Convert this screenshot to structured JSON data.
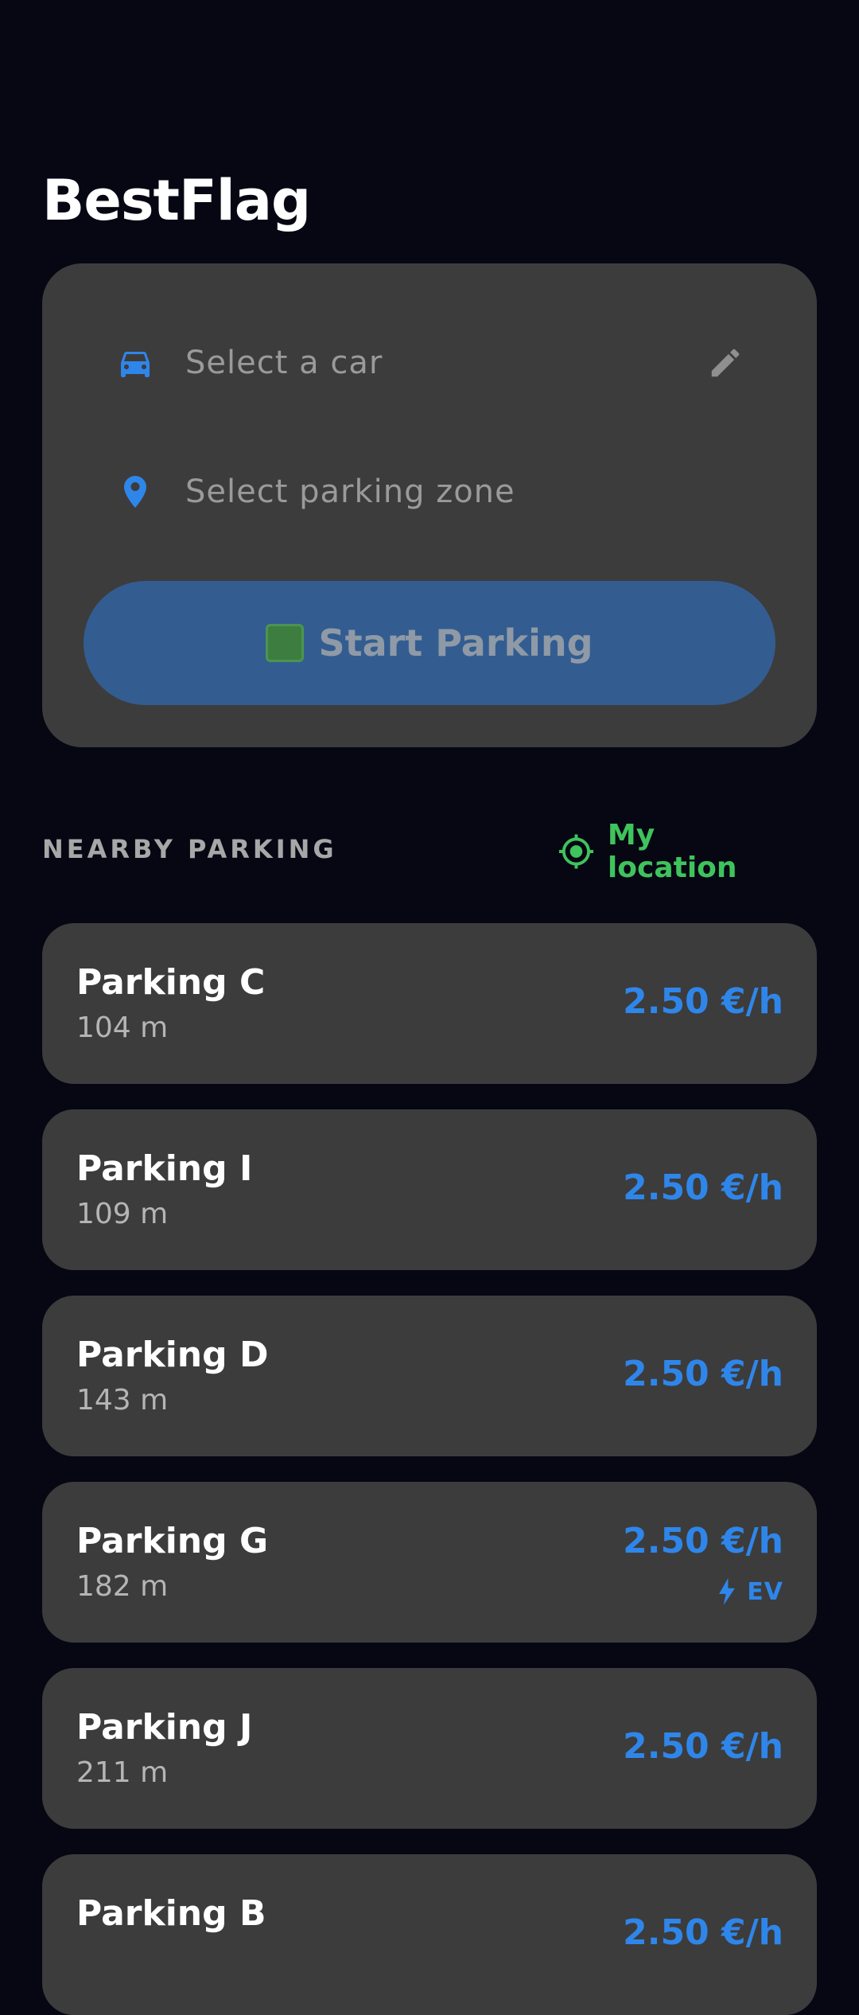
{
  "app": {
    "title": "BestFlag"
  },
  "booking": {
    "car_placeholder": "Select a car",
    "zone_placeholder": "Select parking zone",
    "start_button_label": "Start Parking",
    "icons": {
      "car": "car-icon",
      "zone": "location-pin-icon",
      "edit": "pencil-icon",
      "start": "stop-square-icon"
    }
  },
  "nearby": {
    "section_title": "NEARBY PARKING",
    "location_button_label": "My location",
    "location_icon": "crosshair-icon",
    "items": [
      {
        "name": "Parking C",
        "distance": "104 m",
        "price": "2.50 €/h",
        "ev": ""
      },
      {
        "name": "Parking I",
        "distance": "109 m",
        "price": "2.50 €/h",
        "ev": ""
      },
      {
        "name": "Parking D",
        "distance": "143 m",
        "price": "2.50 €/h",
        "ev": ""
      },
      {
        "name": "Parking G",
        "distance": "182 m",
        "price": "2.50 €/h",
        "ev": "EV"
      },
      {
        "name": "Parking J",
        "distance": "211 m",
        "price": "2.50 €/h",
        "ev": ""
      },
      {
        "name": "Parking B",
        "distance": "",
        "price": "2.50 €/h",
        "ev": ""
      }
    ]
  },
  "colors": {
    "background": "#060713",
    "card": "#3c3c3c",
    "accent_blue": "#2f86ea",
    "accent_green": "#3fc35d",
    "button_blue": "#335d91"
  }
}
